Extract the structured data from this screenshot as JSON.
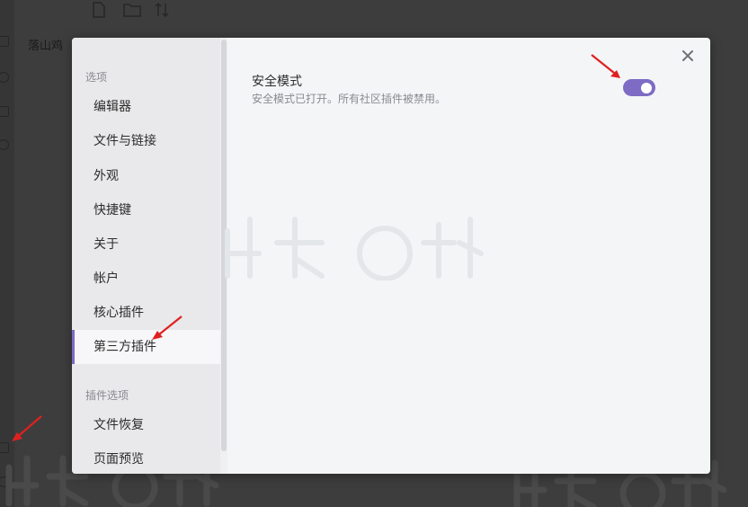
{
  "background": {
    "title": "落山鸡",
    "toolbar_icons": [
      "new-note-icon",
      "folder-icon",
      "sort-icon"
    ]
  },
  "modal": {
    "sections": [
      {
        "title": "选项",
        "items": [
          {
            "label": "编辑器"
          },
          {
            "label": "文件与链接"
          },
          {
            "label": "外观"
          },
          {
            "label": "快捷键"
          },
          {
            "label": "关于"
          },
          {
            "label": "帐户"
          },
          {
            "label": "核心插件"
          },
          {
            "label": "第三方插件",
            "active": true
          }
        ]
      },
      {
        "title": "插件选项",
        "items": [
          {
            "label": "文件恢复"
          },
          {
            "label": "页面预览"
          }
        ]
      }
    ],
    "setting": {
      "name": "安全模式",
      "description": "安全模式已打开。所有社区插件被禁用。",
      "enabled": true
    }
  },
  "colors": {
    "accent": "#7d6bc4",
    "annotation_arrow": "#e02020"
  }
}
